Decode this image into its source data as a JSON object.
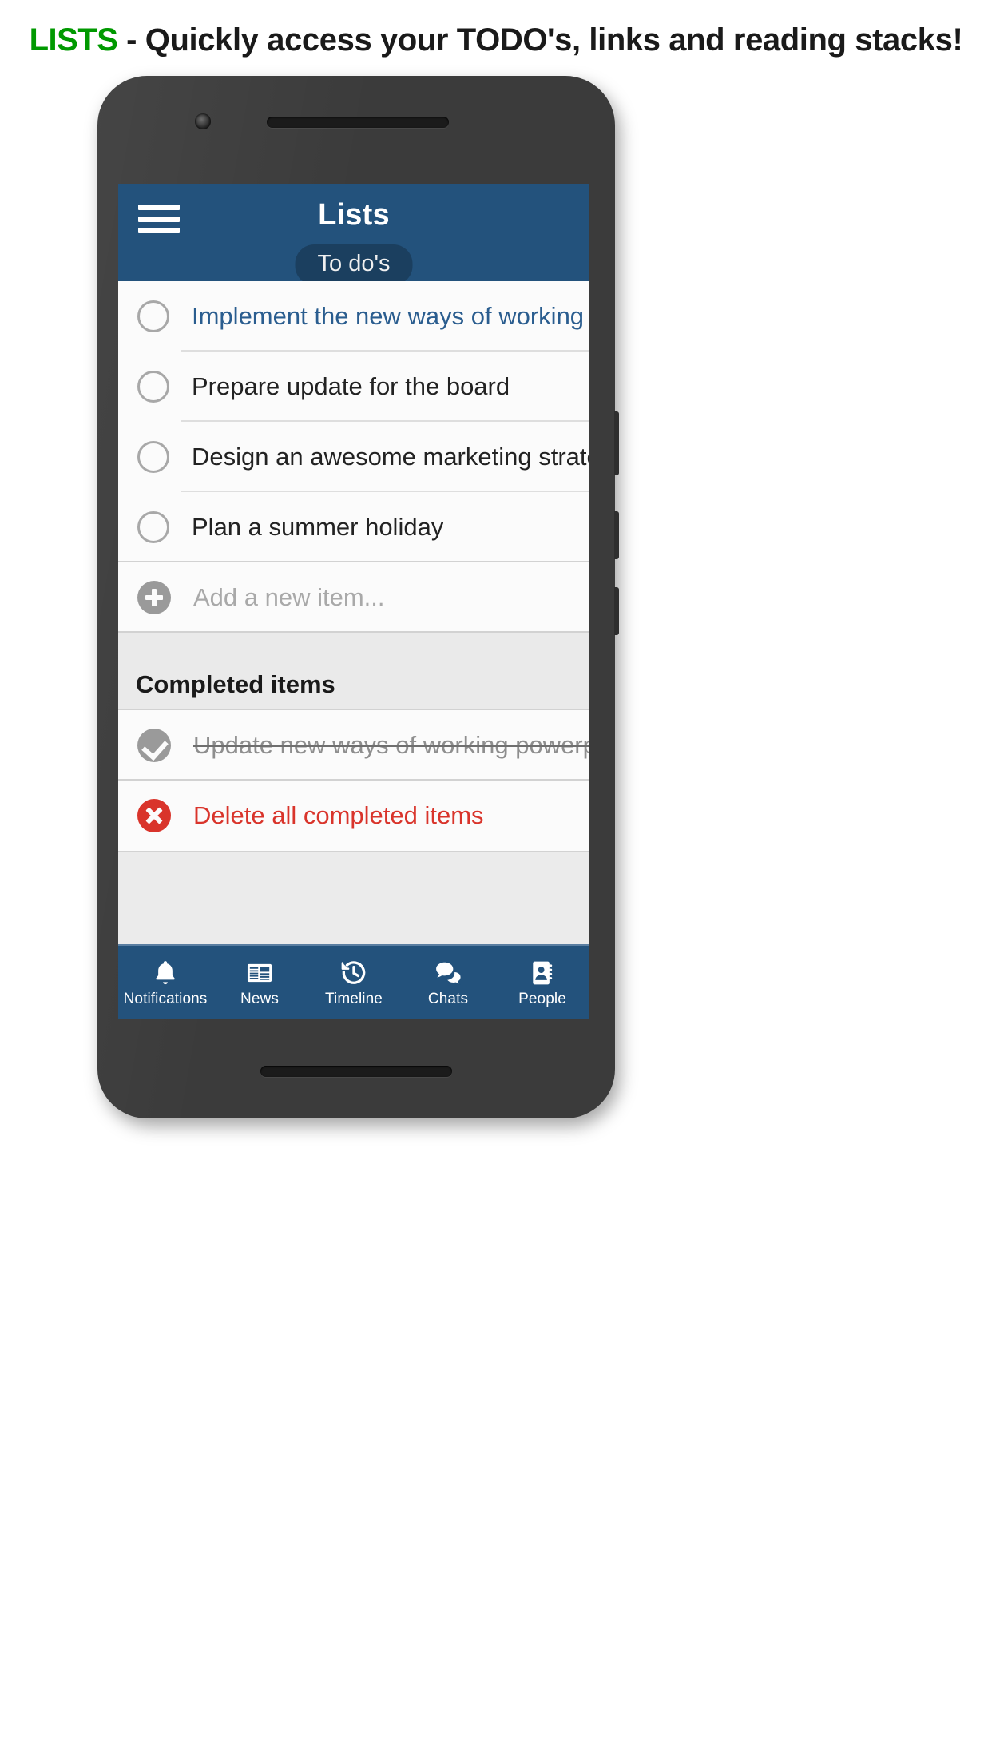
{
  "caption": {
    "highlight": "LISTS",
    "rest": " - Quickly access your TODO's, links and reading stacks!",
    "highlight_color": "#009900"
  },
  "app": {
    "accent_color": "#23527c",
    "appbar": {
      "menu_icon": "hamburger-menu-icon",
      "title": "Lists",
      "list_selector": "To do's"
    },
    "todo_items": [
      {
        "label": "Implement the new ways of working program",
        "checked": false,
        "is_link": true
      },
      {
        "label": "Prepare update for the board",
        "checked": false,
        "is_link": false
      },
      {
        "label": "Design an awesome marketing strategy",
        "checked": false,
        "is_link": false
      },
      {
        "label": "Plan a summer holiday",
        "checked": false,
        "is_link": false
      }
    ],
    "add_row": {
      "icon": "plus-circle-icon",
      "placeholder": "Add a new item..."
    },
    "completed_section": {
      "title": "Completed items",
      "items": [
        {
          "label": "Update new ways of working powerpoint",
          "checked": true
        }
      ],
      "delete_all": {
        "icon": "x-circle-icon",
        "label": "Delete all completed items",
        "color": "#d9342b"
      }
    },
    "tabs": [
      {
        "label": "Notifications",
        "icon": "bell-icon"
      },
      {
        "label": "News",
        "icon": "newspaper-icon"
      },
      {
        "label": "Timeline",
        "icon": "history-clock-icon"
      },
      {
        "label": "Chats",
        "icon": "chat-bubbles-icon"
      },
      {
        "label": "People",
        "icon": "address-book-icon"
      }
    ]
  }
}
